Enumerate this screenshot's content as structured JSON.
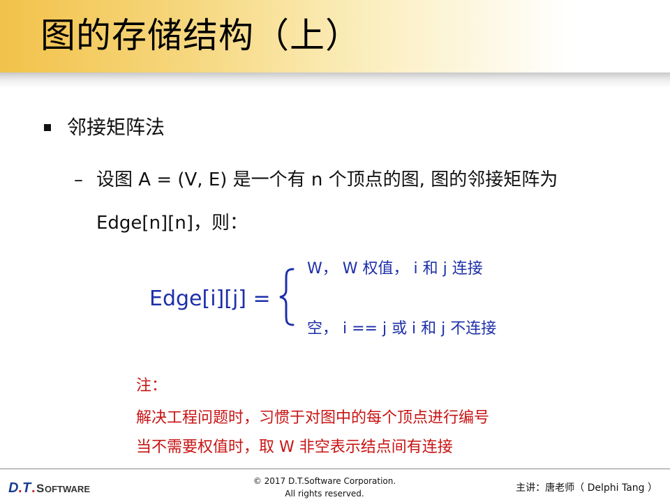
{
  "title": "图的存储结构（上）",
  "bullet1": "邻接矩阵法",
  "sub": {
    "line1": "设图 A = (V, E) 是一个有 n 个顶点的图, 图的邻接矩阵为",
    "line2": "Edge[n][n]，则："
  },
  "formula": {
    "lhs": "Edge[i][j] =",
    "case1": "W， W 权值， i 和 j 连接",
    "case2": "空， i == j 或 i 和 j 不连接"
  },
  "note": {
    "heading": "注：",
    "line1": "解决工程问题时，习惯于对图中的每个顶点进行编号",
    "line2": "当不需要权值时，取 W 非空表示结点间有连接"
  },
  "footer": {
    "logo": "D.T.SOFTWARE",
    "copyright1": "© 2017 D.T.Software Corporation.",
    "copyright2": "All rights reserved.",
    "presenter": "主讲：唐老师（ Delphi Tang ）"
  },
  "colors": {
    "title_band": "#f2c24a",
    "formula": "#1d2fa8",
    "note": "#c81414",
    "logo_blue": "#1a3f8f",
    "logo_red": "#d32027"
  }
}
